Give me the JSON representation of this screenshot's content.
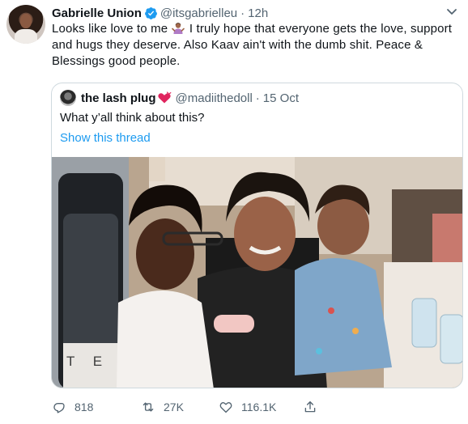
{
  "author": {
    "name": "Gabrielle Union",
    "handle": "@itsgabrielleu",
    "separator": "·",
    "time": "12h",
    "verified_icon": "verified-badge-icon"
  },
  "tweet": {
    "text_part1": "Looks like love to me ",
    "text_part2": " I truly hope that everyone gets the love, support and hugs they deserve. Also Kaav ain't with the dumb shit. Peace & Blessings good people.",
    "emoji": "person-shrugging-emoji"
  },
  "quote": {
    "name": "the lash plug",
    "name_emoji": "heart-icon",
    "handle": "@madiithedoll",
    "separator": "·",
    "date": "15 Oct",
    "text": "What y’all think about this?",
    "link": "Show this thread"
  },
  "actions": {
    "reply_count": "818",
    "retweet_count": "27K",
    "like_count": "116.1K",
    "share_icon": "share-icon"
  },
  "colors": {
    "text": "#0f1419",
    "secondary": "#536471",
    "accent": "#1d9bf0",
    "border": "#cfd9de",
    "heart": "#e0245e"
  }
}
